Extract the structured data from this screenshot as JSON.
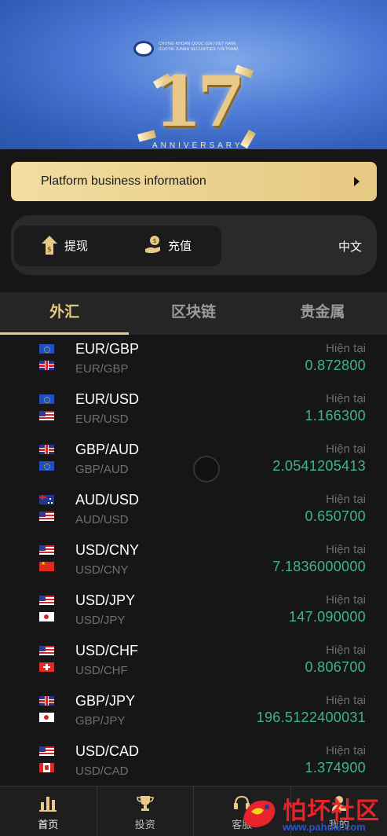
{
  "banner": {
    "logo_lines": [
      "CHỨNG KHOÁN QUỐC GIA (VIỆT NAM)",
      "GUOTAI JUNAN SECURITIES (VIETNAM)"
    ],
    "number": "17",
    "caption": "ANNIVERSARY"
  },
  "info_bar": {
    "label": "Platform business information"
  },
  "actions": {
    "withdraw": "提现",
    "deposit": "充值",
    "language": "中文"
  },
  "tabs": [
    "外汇",
    "区块链",
    "贵金属"
  ],
  "active_tab": 0,
  "price_label": "Hiện tại",
  "pairs": [
    {
      "symbol": "EUR/GBP",
      "sub": "EUR/GBP",
      "value": "0.872800",
      "flag1": "eu",
      "flag2": "uk"
    },
    {
      "symbol": "EUR/USD",
      "sub": "EUR/USD",
      "value": "1.166300",
      "flag1": "eu",
      "flag2": "us"
    },
    {
      "symbol": "GBP/AUD",
      "sub": "GBP/AUD",
      "value": "2.0541205413",
      "flag1": "uk",
      "flag2": "eu"
    },
    {
      "symbol": "AUD/USD",
      "sub": "AUD/USD",
      "value": "0.650700",
      "flag1": "au",
      "flag2": "us"
    },
    {
      "symbol": "USD/CNY",
      "sub": "USD/CNY",
      "value": "7.1836000000",
      "flag1": "us",
      "flag2": "cn"
    },
    {
      "symbol": "USD/JPY",
      "sub": "USD/JPY",
      "value": "147.090000",
      "flag1": "us",
      "flag2": "jp"
    },
    {
      "symbol": "USD/CHF",
      "sub": "USD/CHF",
      "value": "0.806700",
      "flag1": "us",
      "flag2": "ch"
    },
    {
      "symbol": "GBP/JPY",
      "sub": "GBP/JPY",
      "value": "196.5122400031",
      "flag1": "uk",
      "flag2": "jp"
    },
    {
      "symbol": "USD/CAD",
      "sub": "USD/CAD",
      "value": "1.374900",
      "flag1": "us",
      "flag2": "ca"
    }
  ],
  "bottom_nav": [
    {
      "label": "首页",
      "icon": "chart-bars-icon",
      "active": true
    },
    {
      "label": "投资",
      "icon": "trophy-icon",
      "active": false
    },
    {
      "label": "客服",
      "icon": "headset-icon",
      "active": false
    },
    {
      "label": "我的",
      "icon": "user-icon",
      "active": false
    }
  ],
  "watermark": {
    "text": "怕坏社区",
    "url": "www.pahuai.com"
  },
  "colors": {
    "gold": "#e8c986",
    "positive": "#3fb58a",
    "background": "#161616"
  }
}
